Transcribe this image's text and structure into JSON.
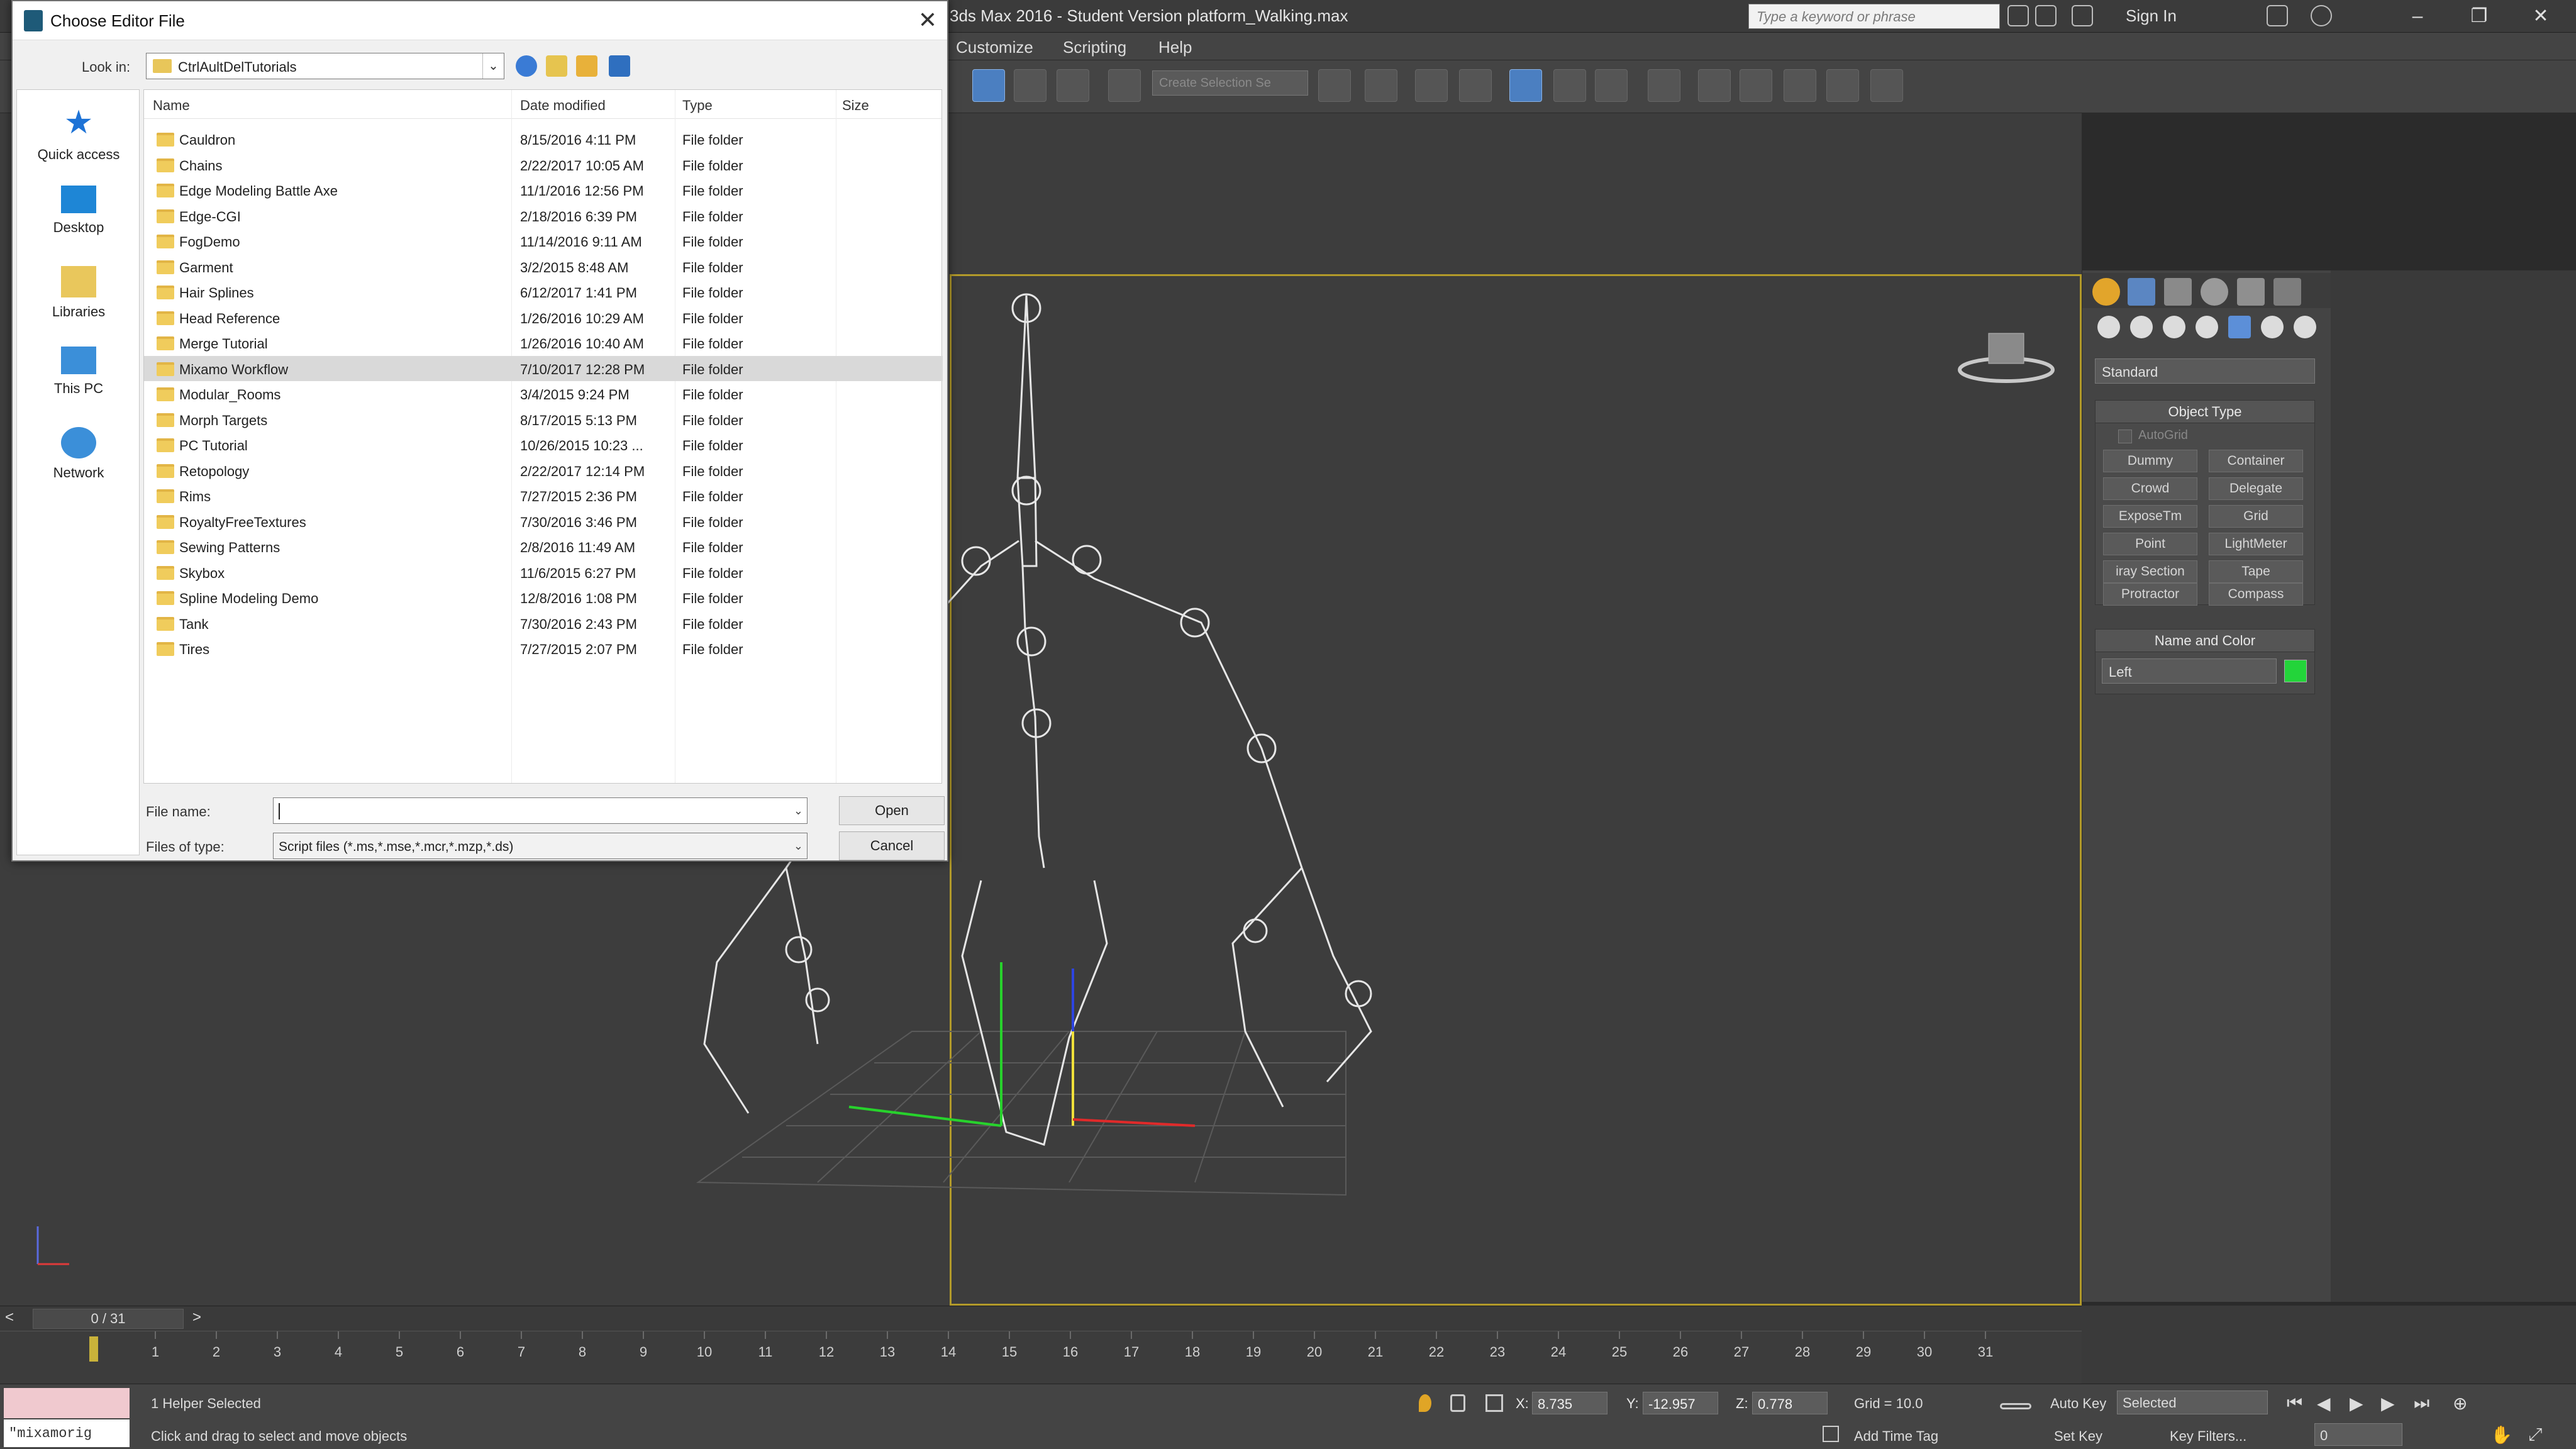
{
  "max": {
    "title": "3ds Max 2016 - Student Version    platform_Walking.max",
    "search_placeholder": "Type a keyword or phrase",
    "sign_in": "Sign In",
    "menus": [
      "Customize",
      "Scripting",
      "Help"
    ],
    "selection_set_placeholder": "Create Selection Se"
  },
  "dialog": {
    "title": "Choose Editor File",
    "look_in_label": "Look in:",
    "look_in_value": "CtrlAultDelTutorials",
    "places": [
      "Quick access",
      "Desktop",
      "Libraries",
      "This PC",
      "Network"
    ],
    "columns": {
      "name": "Name",
      "date": "Date modified",
      "type": "Type",
      "size": "Size"
    },
    "files": [
      {
        "name": "Cauldron",
        "date": "8/15/2016 4:11 PM",
        "type": "File folder"
      },
      {
        "name": "Chains",
        "date": "2/22/2017 10:05 AM",
        "type": "File folder"
      },
      {
        "name": "Edge Modeling Battle Axe",
        "date": "11/1/2016 12:56 PM",
        "type": "File folder"
      },
      {
        "name": "Edge-CGI",
        "date": "2/18/2016 6:39 PM",
        "type": "File folder"
      },
      {
        "name": "FogDemo",
        "date": "11/14/2016 9:11 AM",
        "type": "File folder"
      },
      {
        "name": "Garment",
        "date": "3/2/2015 8:48 AM",
        "type": "File folder"
      },
      {
        "name": "Hair Splines",
        "date": "6/12/2017 1:41 PM",
        "type": "File folder"
      },
      {
        "name": "Head Reference",
        "date": "1/26/2016 10:29 AM",
        "type": "File folder"
      },
      {
        "name": "Merge Tutorial",
        "date": "1/26/2016 10:40 AM",
        "type": "File folder"
      },
      {
        "name": "Mixamo Workflow",
        "date": "7/10/2017 12:28 PM",
        "type": "File folder"
      },
      {
        "name": "Modular_Rooms",
        "date": "3/4/2015 9:24 PM",
        "type": "File folder"
      },
      {
        "name": "Morph Targets",
        "date": "8/17/2015 5:13 PM",
        "type": "File folder"
      },
      {
        "name": "PC Tutorial",
        "date": "10/26/2015 10:23 ...",
        "type": "File folder"
      },
      {
        "name": "Retopology",
        "date": "2/22/2017 12:14 PM",
        "type": "File folder"
      },
      {
        "name": "Rims",
        "date": "7/27/2015 2:36 PM",
        "type": "File folder"
      },
      {
        "name": "RoyaltyFreeTextures",
        "date": "7/30/2016 3:46 PM",
        "type": "File folder"
      },
      {
        "name": "Sewing Patterns",
        "date": "2/8/2016 11:49 AM",
        "type": "File folder"
      },
      {
        "name": "Skybox",
        "date": "11/6/2015 6:27 PM",
        "type": "File folder"
      },
      {
        "name": "Spline Modeling Demo",
        "date": "12/8/2016 1:08 PM",
        "type": "File folder"
      },
      {
        "name": "Tank",
        "date": "7/30/2016 2:43 PM",
        "type": "File folder"
      },
      {
        "name": "Tires",
        "date": "7/27/2015 2:07 PM",
        "type": "File folder"
      }
    ],
    "highlighted_file": "Mixamo Workflow",
    "file_name_label": "File name:",
    "file_name_value": "",
    "files_of_type_label": "Files of type:",
    "files_of_type_value": "Script files (*.ms,*.mse,*.mcr,*.mzp,*.ds)",
    "open_label": "Open",
    "cancel_label": "Cancel"
  },
  "command_panel": {
    "dropdown": "Standard",
    "object_type_title": "Object Type",
    "autogrid": "AutoGrid",
    "buttons": [
      "Dummy",
      "Container",
      "Crowd",
      "Delegate",
      "ExposeTm",
      "Grid",
      "Point",
      "LightMeter",
      "iray Section",
      "Tape",
      "Protractor",
      "Compass"
    ],
    "name_color_title": "Name and Color",
    "object_name": "Left",
    "object_color": "#23d43a"
  },
  "timeline": {
    "frame_counter": "0 / 31",
    "ticks": [
      1,
      2,
      3,
      4,
      5,
      6,
      7,
      8,
      9,
      10,
      11,
      12,
      13,
      14,
      15,
      16,
      17,
      18,
      19,
      20,
      21,
      22,
      23,
      24,
      25,
      26,
      27,
      28,
      29,
      30,
      31
    ]
  },
  "status": {
    "maxscript_output": "\"mixamorig",
    "selection_status": "1 Helper Selected",
    "prompt": "Click and drag to select and move objects",
    "x_label": "X:",
    "x_value": "8.735",
    "y_label": "Y:",
    "y_value": "-12.957",
    "z_label": "Z:",
    "z_value": "0.778",
    "grid": "Grid = 10.0",
    "add_time_tag": "Add Time Tag",
    "auto_key": "Auto Key",
    "set_key": "Set Key",
    "selected": "Selected",
    "key_filters": "Key Filters...",
    "frame": "0"
  }
}
